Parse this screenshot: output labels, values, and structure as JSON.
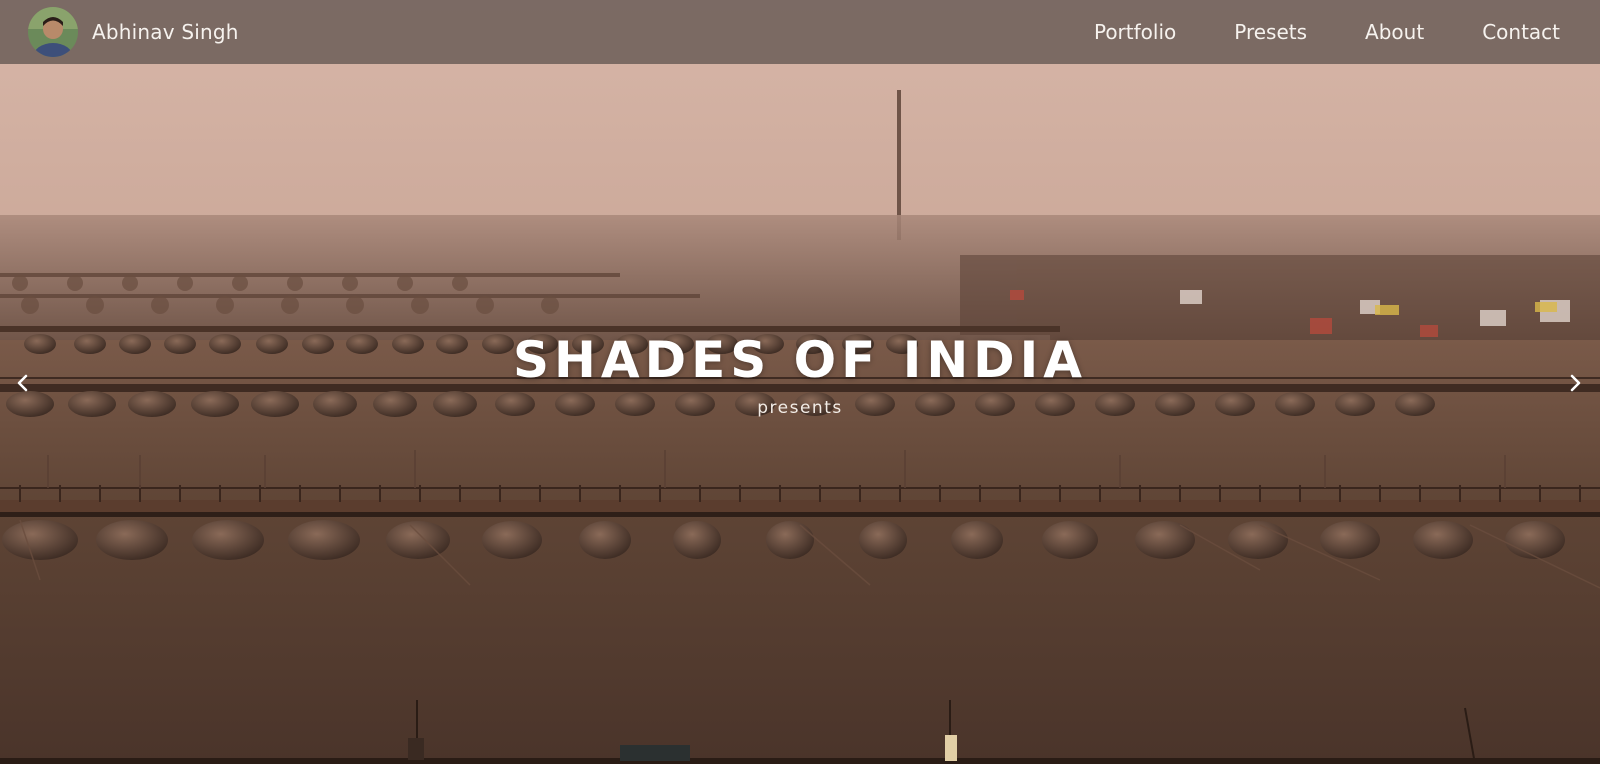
{
  "brand": {
    "name": "Abhinav Singh",
    "avatar_icon": "avatar-photo"
  },
  "nav": {
    "items": [
      {
        "label": "Portfolio"
      },
      {
        "label": "Presets"
      },
      {
        "label": "About"
      },
      {
        "label": "Contact"
      }
    ]
  },
  "hero": {
    "title": "SHADES OF INDIA",
    "subtitle": "presents",
    "prev_icon": "chevron-left-icon",
    "next_icon": "chevron-right-icon"
  },
  "colors": {
    "navbar": "#6e605a",
    "text": "#ffffff",
    "sky": "#c9a79a",
    "water": "#5a4336"
  }
}
